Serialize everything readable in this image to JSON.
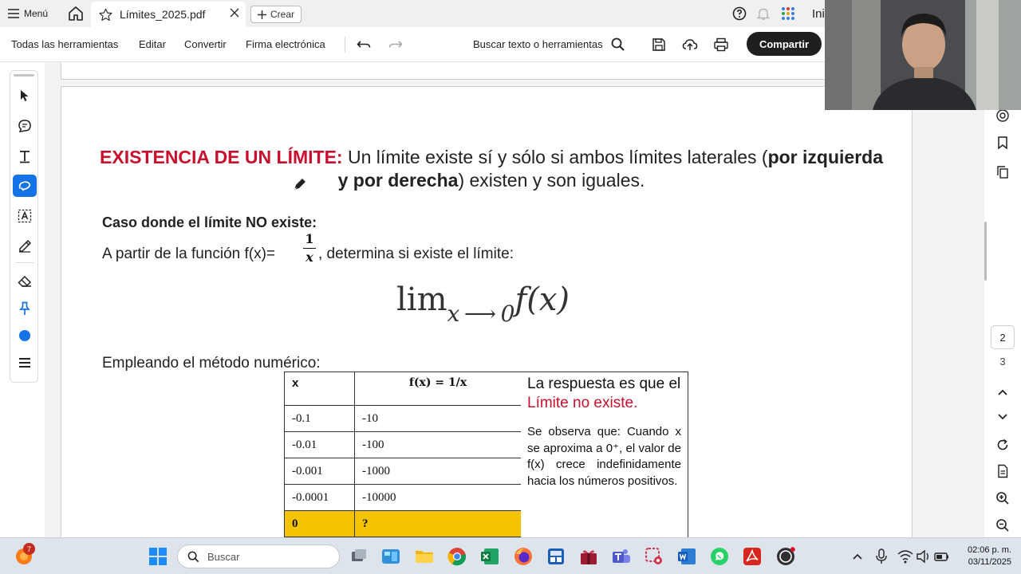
{
  "tabbar": {
    "menu_label": "Menú",
    "tab_title": "Límites_2025.pdf",
    "create_label": "Crear",
    "partial_label": "Ini"
  },
  "toolbar": {
    "all_tools": "Todas las herramientas",
    "edit": "Editar",
    "convert": "Convertir",
    "esign": "Firma electrónica",
    "search_label": "Buscar texto o herramientas",
    "share": "Compartir"
  },
  "document": {
    "title_red": "EXISTENCIA DE UN LÍMITE:",
    "title_part1": " Un límite existe sí y sólo si ambos límites laterales (",
    "title_bold": "por izquierda y por derecha",
    "title_part2": ") existen y son iguales.",
    "case_heading": "Caso donde el límite NO existe:",
    "intro_text": "A partir de la función f(x)=",
    "frac_num": "1",
    "frac_den": "x",
    "intro_text2": ", determina si existe el límite:",
    "limit_lim": "lim",
    "limit_sub": "x ⟶ 0",
    "limit_fx": "f(x)",
    "method_text": "Empleando el método numérico:",
    "table": {
      "header_x": "x",
      "header_fx": "f(x) = 1/x",
      "rows": [
        {
          "x": "-0.1",
          "fx": "-10"
        },
        {
          "x": "-0.01",
          "fx": "-100"
        },
        {
          "x": "-0.001",
          "fx": "-1000"
        },
        {
          "x": "-0.0001",
          "fx": "-10000"
        },
        {
          "x": "0",
          "fx": "?"
        }
      ]
    },
    "answer_main": "La respuesta es que el ",
    "answer_red": "Límite no existe.",
    "observation": "Se observa que: Cuando x se aproxima a 0⁺, el valor de f(x) crece indefinidamente hacia los números positivos."
  },
  "rightrail": {
    "current_page": "2",
    "next_page": "3"
  },
  "taskbar": {
    "search_placeholder": "Buscar",
    "notification_count": "7",
    "time": "02:06 p. m.",
    "date": "03/11/2025"
  },
  "colors": {
    "accent_blue": "#1473e6",
    "title_red": "#c8102e",
    "highlight_yellow": "#f5c400",
    "share_button": "#1f1f1f"
  }
}
